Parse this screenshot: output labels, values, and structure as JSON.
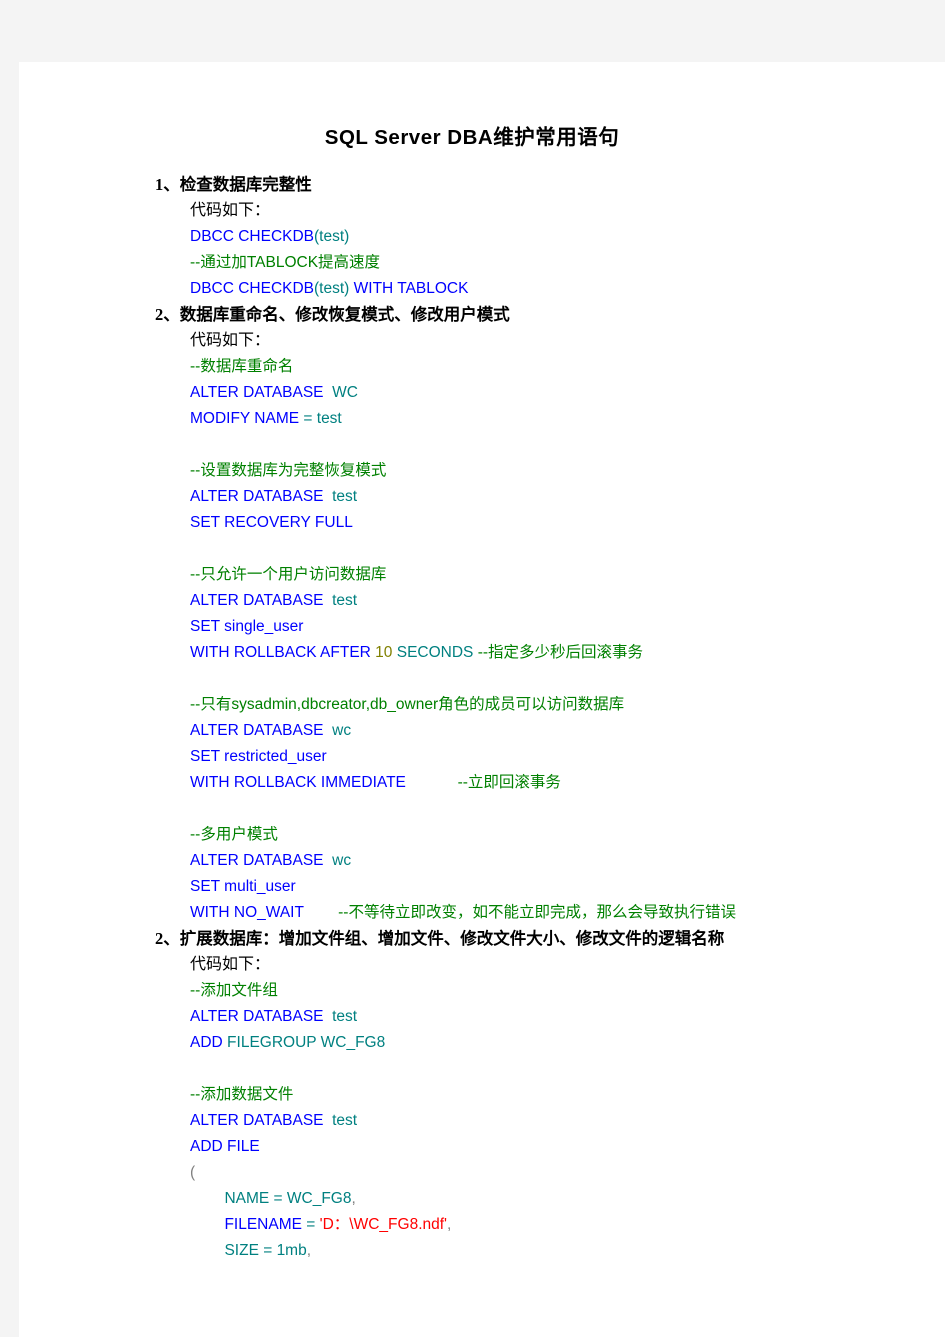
{
  "document": {
    "title": "SQL  Server  DBA维护常用语句",
    "code_label": "代码如下：",
    "sections": [
      {
        "heading": "1、检查数据库完整性",
        "code_label": "代码如下：",
        "lines": [
          [
            {
              "t": "DBCC CHECKDB",
              "c": "kw"
            },
            {
              "t": "(test)",
              "c": "id"
            }
          ],
          [
            {
              "t": "--通过加TABLOCK提高速度",
              "c": "cmt"
            }
          ],
          [
            {
              "t": "DBCC CHECKDB",
              "c": "kw"
            },
            {
              "t": "(test)",
              "c": "id"
            },
            {
              "t": " ",
              "c": "plain"
            },
            {
              "t": "WITH TABLOCK",
              "c": "kw"
            }
          ]
        ]
      },
      {
        "heading": "2、数据库重命名、修改恢复模式、修改用户模式",
        "code_label": "代码如下：",
        "lines": [
          [
            {
              "t": "--数据库重命名",
              "c": "cmt"
            }
          ],
          [
            {
              "t": "ALTER DATABASE ",
              "c": "kw"
            },
            {
              "t": " WC",
              "c": "id"
            }
          ],
          [
            {
              "t": "MODIFY NAME",
              "c": "kw"
            },
            {
              "t": " = test",
              "c": "id"
            }
          ],
          [],
          [
            {
              "t": "--设置数据库为完整恢复模式",
              "c": "cmt"
            }
          ],
          [
            {
              "t": "ALTER DATABASE ",
              "c": "kw"
            },
            {
              "t": " test",
              "c": "id"
            }
          ],
          [
            {
              "t": "SET RECOVERY FULL",
              "c": "kw"
            }
          ],
          [],
          [
            {
              "t": "--只允许一个用户访问数据库",
              "c": "cmt"
            }
          ],
          [
            {
              "t": "ALTER DATABASE ",
              "c": "kw"
            },
            {
              "t": " test",
              "c": "id"
            }
          ],
          [
            {
              "t": "SET single_user",
              "c": "kw"
            }
          ],
          [
            {
              "t": "WITH ROLLBACK AFTER ",
              "c": "kw"
            },
            {
              "t": "10",
              "c": "num"
            },
            {
              "t": " SECONDS ",
              "c": "id"
            },
            {
              "t": "--指定多少秒后回滚事务",
              "c": "cmt"
            }
          ],
          [],
          [
            {
              "t": "--只有sysadmin,dbcreator,db_owner角色的成员可以访问数据库",
              "c": "cmt"
            }
          ],
          [
            {
              "t": "ALTER DATABASE ",
              "c": "kw"
            },
            {
              "t": " wc",
              "c": "id"
            }
          ],
          [
            {
              "t": "SET restricted_user",
              "c": "kw"
            }
          ],
          [
            {
              "t": "WITH ROLLBACK IMMEDIATE",
              "c": "kw"
            },
            {
              "t": "            ",
              "c": "plain"
            },
            {
              "t": "--立即回滚事务",
              "c": "cmt"
            }
          ],
          [],
          [
            {
              "t": "--多用户模式",
              "c": "cmt"
            }
          ],
          [
            {
              "t": "ALTER DATABASE ",
              "c": "kw"
            },
            {
              "t": " wc",
              "c": "id"
            }
          ],
          [
            {
              "t": "SET multi_user",
              "c": "kw"
            }
          ],
          [
            {
              "t": "WITH ",
              "c": "kw"
            },
            {
              "t": "NO_WAIT",
              "c": "kw"
            },
            {
              "t": "        ",
              "c": "plain"
            },
            {
              "t": "--不等待立即改变，如不能立即完成，那么会导致执行错误",
              "c": "cmt"
            }
          ]
        ]
      },
      {
        "heading": "2、扩展数据库：增加文件组、增加文件、修改文件大小、修改文件的逻辑名称",
        "code_label": "代码如下：",
        "lines": [
          [
            {
              "t": "--添加文件组",
              "c": "cmt"
            }
          ],
          [
            {
              "t": "ALTER DATABASE ",
              "c": "kw"
            },
            {
              "t": " test",
              "c": "id"
            }
          ],
          [
            {
              "t": "ADD ",
              "c": "kw"
            },
            {
              "t": "FILEGROUP WC_FG8",
              "c": "id"
            }
          ],
          [],
          [
            {
              "t": "--添加数据文件",
              "c": "cmt"
            }
          ],
          [
            {
              "t": "ALTER DATABASE ",
              "c": "kw"
            },
            {
              "t": " test",
              "c": "id"
            }
          ],
          [
            {
              "t": "ADD FILE",
              "c": "kw"
            }
          ],
          [
            {
              "t": "(",
              "c": "punct"
            }
          ],
          [
            {
              "t": "        NAME = WC_FG8",
              "c": "id"
            },
            {
              "t": ",",
              "c": "punct"
            }
          ],
          [
            {
              "t": "        FILENAME",
              "c": "kw"
            },
            {
              "t": " = ",
              "c": "id"
            },
            {
              "t": "'D：\\WC_FG8.ndf'",
              "c": "str"
            },
            {
              "t": ",",
              "c": "punct"
            }
          ],
          [
            {
              "t": "        SIZE = 1mb",
              "c": "id"
            },
            {
              "t": ",",
              "c": "punct"
            }
          ]
        ]
      }
    ]
  }
}
